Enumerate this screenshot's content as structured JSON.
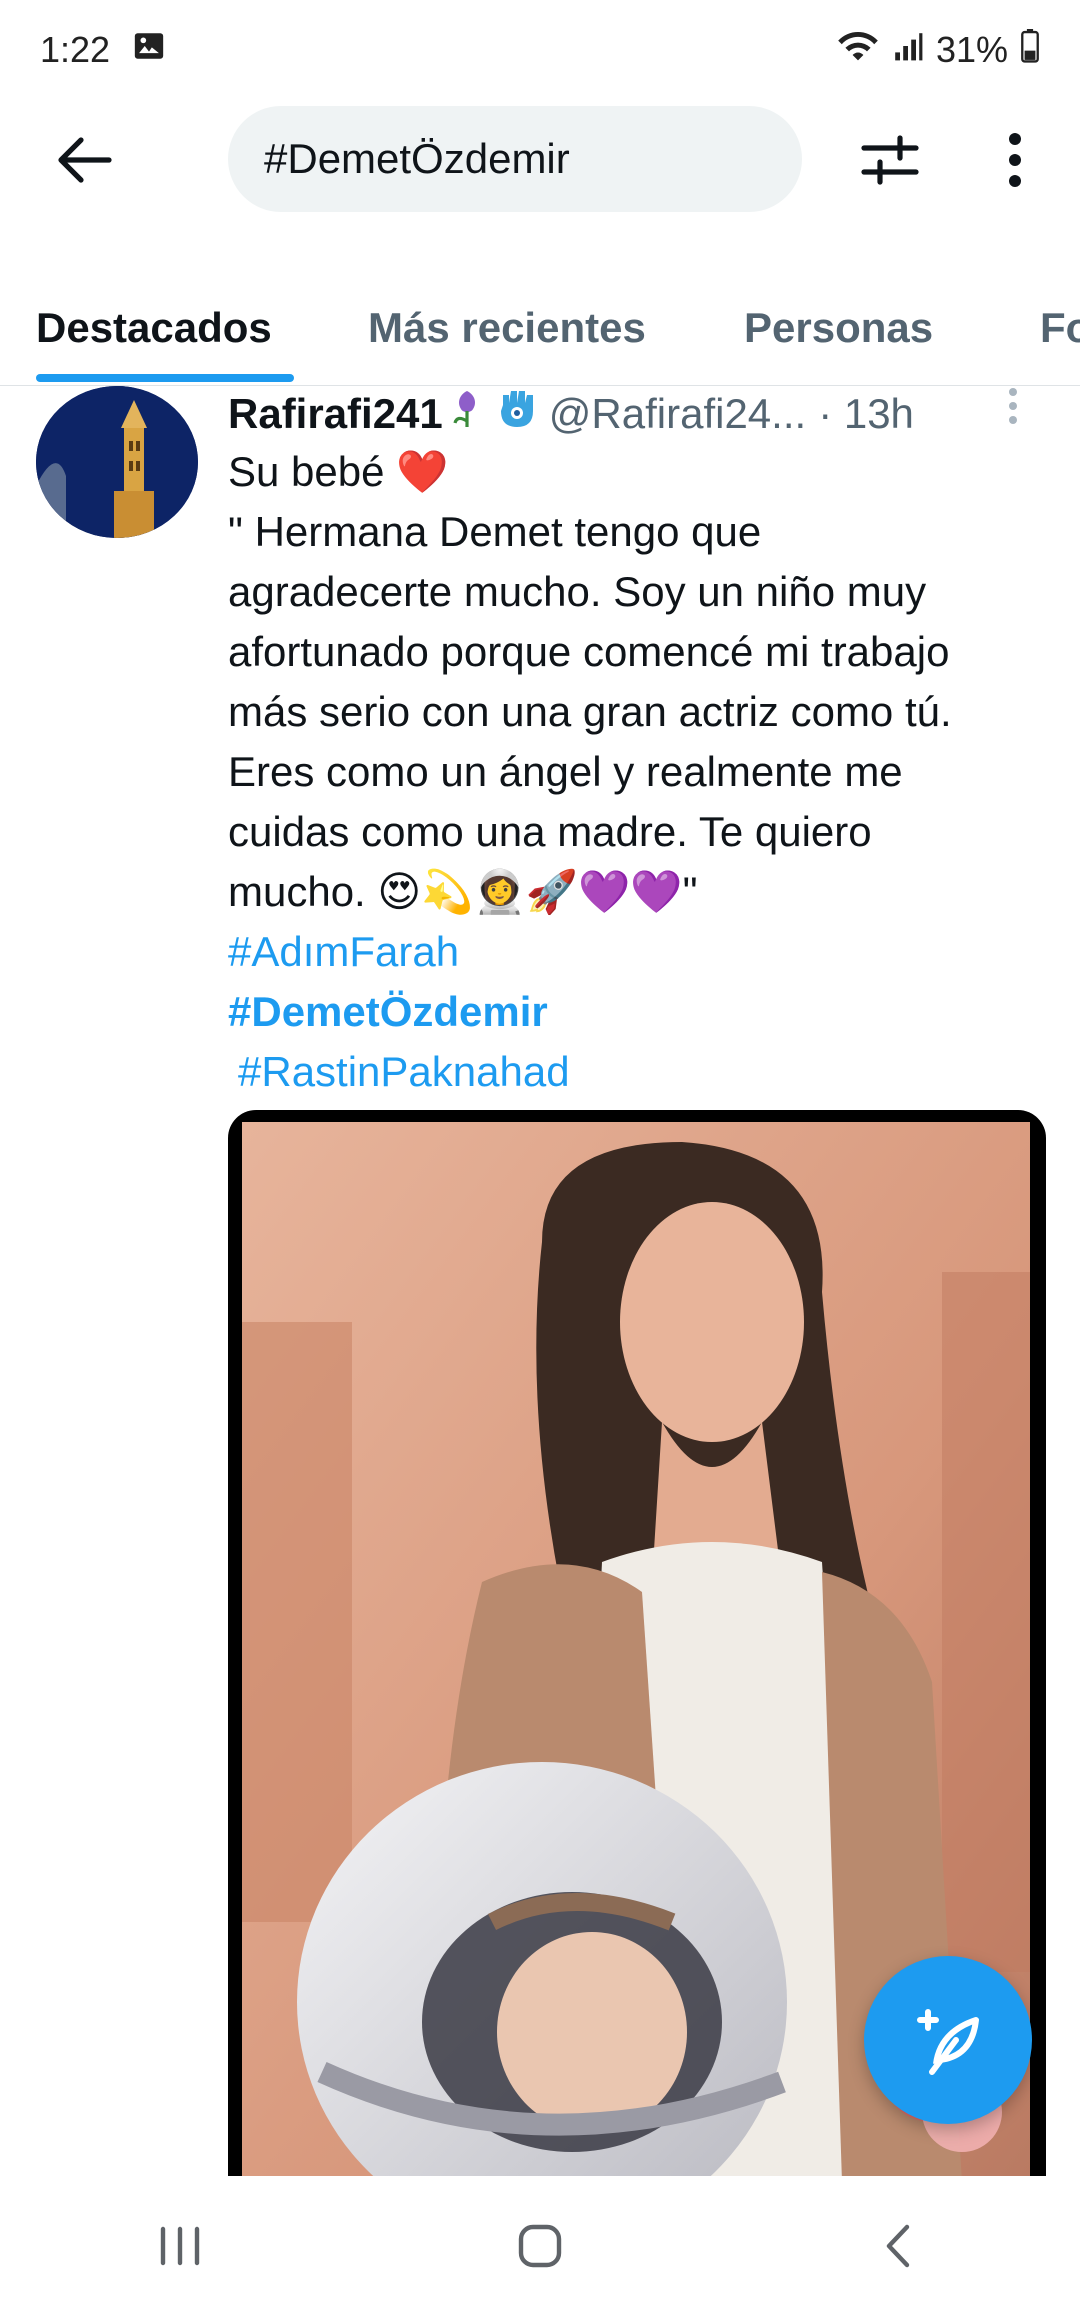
{
  "status_bar": {
    "time": "1:22",
    "battery": "31%",
    "icons": [
      "gallery-icon",
      "wifi-icon",
      "signal-icon",
      "battery-icon"
    ]
  },
  "search": {
    "query": "#DemetÖzdemir"
  },
  "tabs": [
    {
      "label": "Destacados",
      "active": true
    },
    {
      "label": "Más recientes",
      "active": false
    },
    {
      "label": "Personas",
      "active": false
    },
    {
      "label": "Fo",
      "active": false
    }
  ],
  "tweet": {
    "display_name": "Rafirafi241",
    "handle": "@Rafirafi24...",
    "time": "· 13h",
    "lines": [
      "Su bebé ❤️",
      "\" Hermana Demet tengo que",
      "agradecerte mucho. Soy un niño muy",
      "afortunado porque comencé mi trabajo",
      "más serio con una gran actriz como tú.",
      "Eres como un ángel y realmente me",
      "cuidas  como una madre. Te quiero",
      "mucho. 😍💫👩‍🚀🚀💜💜\""
    ],
    "hashtags": [
      "#AdımFarah",
      "#DemetÖzdemir",
      "#RastinPaknahad"
    ]
  },
  "colors": {
    "accent": "#1d9bf0",
    "text_primary": "#0f1419",
    "text_secondary": "#536471",
    "search_bg": "#eff3f4"
  }
}
